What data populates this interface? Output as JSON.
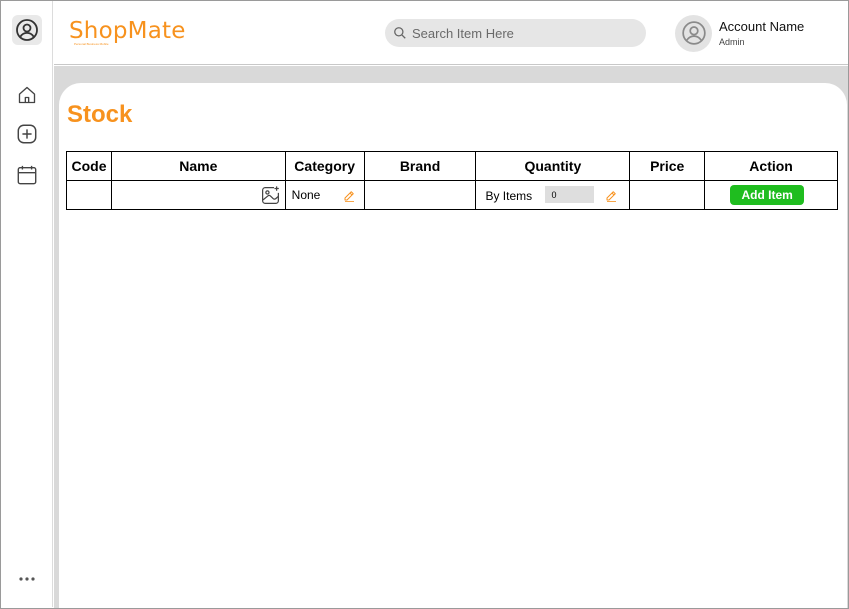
{
  "app": {
    "logo_text": "ShopMate",
    "logo_tagline": "Personal Business Mobile"
  },
  "search": {
    "placeholder": "Search Item Here"
  },
  "account": {
    "name": "Account Name",
    "role": "Admin"
  },
  "sidebar": {
    "items": [
      {
        "icon": "user-circle-icon"
      },
      {
        "icon": "home-icon"
      },
      {
        "icon": "plus-square-icon"
      },
      {
        "icon": "calendar-icon"
      },
      {
        "icon": "more-dots-icon"
      }
    ]
  },
  "page": {
    "title": "Stock"
  },
  "table": {
    "columns": [
      "Code",
      "Name",
      "Category",
      "Brand",
      "Quantity",
      "Price",
      "Action"
    ],
    "rows": [
      {
        "code": "",
        "name": "",
        "category": "None",
        "brand": "",
        "quantity_unit": "By Items",
        "quantity_value": "0",
        "price": "",
        "action_label": "Add Item"
      }
    ]
  },
  "colors": {
    "accent": "#f7921e",
    "action_green": "#1fbd1f",
    "content_bg": "#d9d9d9"
  }
}
